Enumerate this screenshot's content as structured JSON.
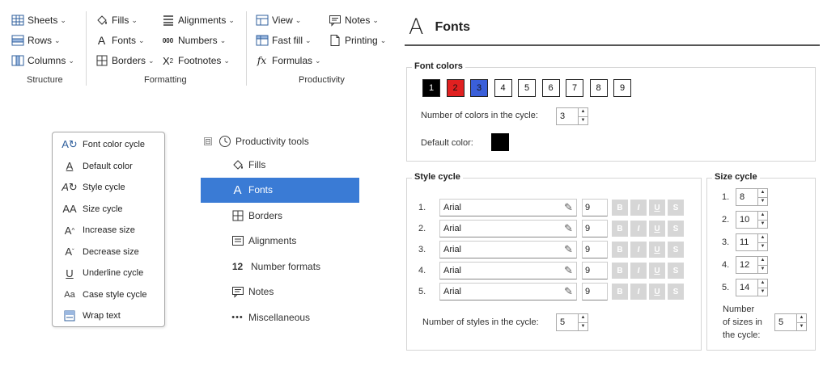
{
  "ribbon": {
    "groups": [
      {
        "label": "Structure",
        "buttons": [
          {
            "icon": "sheets-icon",
            "label": "Sheets"
          },
          {
            "icon": "rows-icon",
            "label": "Rows"
          },
          {
            "icon": "columns-icon",
            "label": "Columns"
          }
        ]
      },
      {
        "label": "Formatting",
        "buttons": [
          {
            "icon": "fills-icon",
            "label": "Fills"
          },
          {
            "icon": "fonts-icon",
            "label": "Fonts"
          },
          {
            "icon": "borders-icon",
            "label": "Borders"
          },
          {
            "icon": "alignments-icon",
            "label": "Alignments"
          },
          {
            "icon": "numbers-icon",
            "label": "Numbers",
            "icon_text": "000"
          },
          {
            "icon": "footnotes-icon",
            "label": "Footnotes"
          }
        ]
      },
      {
        "label": "Productivity",
        "buttons": [
          {
            "icon": "view-icon",
            "label": "View"
          },
          {
            "icon": "fast-fill-icon",
            "label": "Fast fill"
          },
          {
            "icon": "formulas-icon",
            "label": "Formulas"
          },
          {
            "icon": "notes-icon",
            "label": "Notes"
          },
          {
            "icon": "printing-icon",
            "label": "Printing"
          }
        ]
      }
    ]
  },
  "menu": {
    "items": [
      {
        "icon": "font-color-cycle-icon",
        "label": "Font color cycle"
      },
      {
        "icon": "default-color-icon",
        "label": "Default color"
      },
      {
        "icon": "style-cycle-icon",
        "label": "Style cycle"
      },
      {
        "icon": "size-cycle-icon",
        "label": "Size cycle"
      },
      {
        "icon": "increase-size-icon",
        "label": "Increase size"
      },
      {
        "icon": "decrease-size-icon",
        "label": "Decrease size"
      },
      {
        "icon": "underline-cycle-icon",
        "label": "Underline cycle"
      },
      {
        "icon": "case-style-cycle-icon",
        "label": "Case style cycle"
      },
      {
        "icon": "wrap-text-icon",
        "label": "Wrap text"
      }
    ]
  },
  "tree": {
    "root": {
      "label": "Productivity tools",
      "expander": "⊟",
      "icon": "clock-icon"
    },
    "items": [
      {
        "icon": "fills-icon",
        "label": "Fills",
        "selected": false
      },
      {
        "icon": "fonts-icon",
        "label": "Fonts",
        "selected": true
      },
      {
        "icon": "borders-icon",
        "label": "Borders",
        "selected": false
      },
      {
        "icon": "alignments-icon",
        "label": "Alignments",
        "selected": false
      },
      {
        "icon": "number-formats-icon",
        "icon_text": "12",
        "label": "Number formats",
        "selected": false
      },
      {
        "icon": "notes-icon",
        "label": "Notes",
        "selected": false
      },
      {
        "icon": "miscellaneous-icon",
        "label": "Miscellaneous",
        "selected": false
      }
    ]
  },
  "panel": {
    "title": "Fonts",
    "font_colors": {
      "legend": "Font colors",
      "swatches": [
        {
          "label": "1",
          "color": "#000000",
          "text_color": "#ffffff"
        },
        {
          "label": "2",
          "color": "#e02020",
          "text_color": "#111111"
        },
        {
          "label": "3",
          "color": "#3a5fd9",
          "text_color": "#111111"
        },
        {
          "label": "4",
          "color": "#ffffff",
          "text_color": "#111111"
        },
        {
          "label": "5",
          "color": "#ffffff",
          "text_color": "#111111"
        },
        {
          "label": "6",
          "color": "#ffffff",
          "text_color": "#111111"
        },
        {
          "label": "7",
          "color": "#ffffff",
          "text_color": "#111111"
        },
        {
          "label": "8",
          "color": "#ffffff",
          "text_color": "#111111"
        },
        {
          "label": "9",
          "color": "#ffffff",
          "text_color": "#111111"
        }
      ],
      "count_label": "Number of colors in the cycle:",
      "count_value": "3",
      "default_label": "Default color:",
      "default_color": "#000000"
    },
    "style_cycle": {
      "legend": "Style cycle",
      "rows": [
        {
          "num": "1.",
          "font": "Arial",
          "size": "9"
        },
        {
          "num": "2.",
          "font": "Arial",
          "size": "9"
        },
        {
          "num": "3.",
          "font": "Arial",
          "size": "9"
        },
        {
          "num": "4.",
          "font": "Arial",
          "size": "9"
        },
        {
          "num": "5.",
          "font": "Arial",
          "size": "9"
        }
      ],
      "buttons": [
        "B",
        "I",
        "U",
        "S"
      ],
      "count_label": "Number of styles in the cycle:",
      "count_value": "5"
    },
    "size_cycle": {
      "legend": "Size cycle",
      "rows": [
        {
          "num": "1.",
          "value": "8"
        },
        {
          "num": "2.",
          "value": "10"
        },
        {
          "num": "3.",
          "value": "11"
        },
        {
          "num": "4.",
          "value": "12"
        },
        {
          "num": "5.",
          "value": "14"
        }
      ],
      "count_label_1": "Number",
      "count_label_2": "of sizes in",
      "count_label_3": "the cycle:",
      "count_value": "5"
    }
  }
}
